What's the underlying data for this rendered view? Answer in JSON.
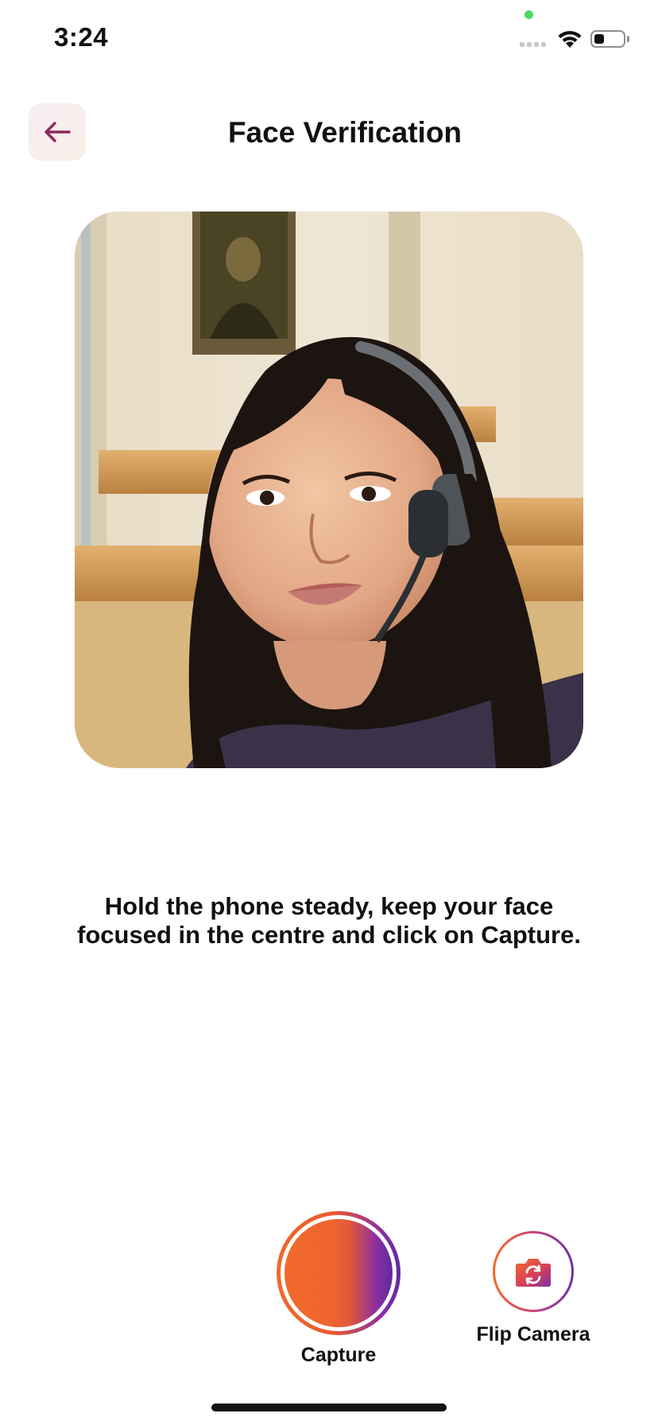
{
  "status_bar": {
    "time": "3:24",
    "icons": [
      "privacy-indicator-icon",
      "signal-icon",
      "wifi-icon",
      "battery-icon"
    ]
  },
  "header": {
    "back_icon": "arrow-left-icon",
    "title": "Face Verification"
  },
  "camera": {
    "content": "live-camera-preview"
  },
  "instruction": {
    "text": "Hold the phone steady, keep your face focused in the centre and click on Capture."
  },
  "controls": {
    "capture_label": "Capture",
    "flip_label": "Flip Camera",
    "flip_icon": "flip-camera-icon"
  },
  "colors": {
    "accent_orange": "#f06a2a",
    "accent_purple": "#6b2fa5",
    "back_arrow": "#8a2a5c",
    "back_bg": "#f6eef3"
  }
}
